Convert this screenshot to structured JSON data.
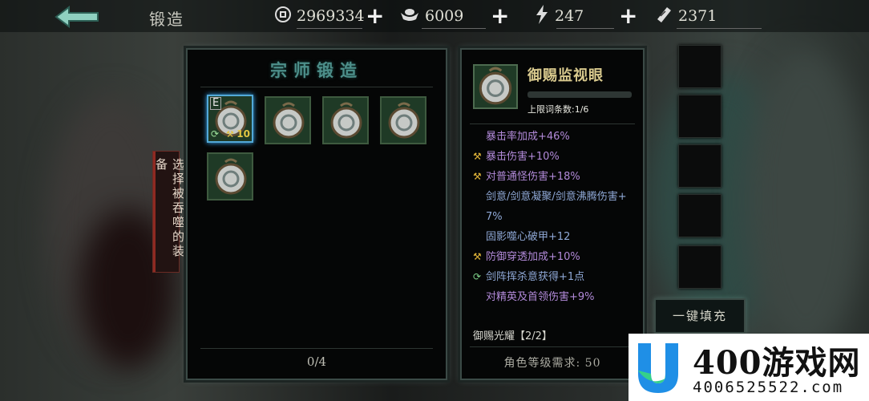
{
  "header": {
    "title": "锻造",
    "resources": [
      {
        "icon": "coin-icon",
        "value": "2969334"
      },
      {
        "icon": "ingot-icon",
        "value": "6009"
      },
      {
        "icon": "lightning-icon",
        "value": "247"
      },
      {
        "icon": "ticket-icon",
        "value": "2371"
      }
    ]
  },
  "left_panel": {
    "title": "宗师锻造",
    "counter": "0/4",
    "selected_slot": {
      "badge": "E",
      "level": "10"
    }
  },
  "side_label": "选择被吞噬的装备",
  "item": {
    "name": "御赐监视眼",
    "cap_text": "上限词条数:1/6",
    "stats": [
      {
        "icon": "",
        "text": "暴击率加成+46%",
        "style": "purple"
      },
      {
        "icon": "hammer-icon",
        "text": "暴击伤害+10%",
        "style": "purple"
      },
      {
        "icon": "hammer-icon",
        "text": "对普通怪伤害+18%",
        "style": "purple"
      },
      {
        "icon": "",
        "text": "剑意/剑意凝聚/剑意沸腾伤害+",
        "style": "blue"
      },
      {
        "icon": "",
        "text": "7%",
        "style": "blue"
      },
      {
        "icon": "",
        "text": "固影噬心破甲+12",
        "style": "blue"
      },
      {
        "icon": "hammer-icon",
        "text": "防御穿透加成+10%",
        "style": "purple"
      },
      {
        "icon": "refresh-icon",
        "text": "剑阵挥杀意获得+1点",
        "style": "blue"
      },
      {
        "icon": "",
        "text": "对精英及首领伤害+9%",
        "style": "purple"
      }
    ],
    "set_name": "御赐光耀【2/2】",
    "requirement": "角色等级需求: 50"
  },
  "fill_button": "一键填充",
  "watermark": {
    "brand": "400游戏网",
    "number": "4006525522.com"
  },
  "colors": {
    "title_teal": "#4d8f8a",
    "item_name_gold": "#d9ca8e",
    "stat_purple": "#b28ad9",
    "stat_blue": "#8fa8d6",
    "selected_border": "#52a9d8",
    "side_label_red": "#8f2a22"
  }
}
